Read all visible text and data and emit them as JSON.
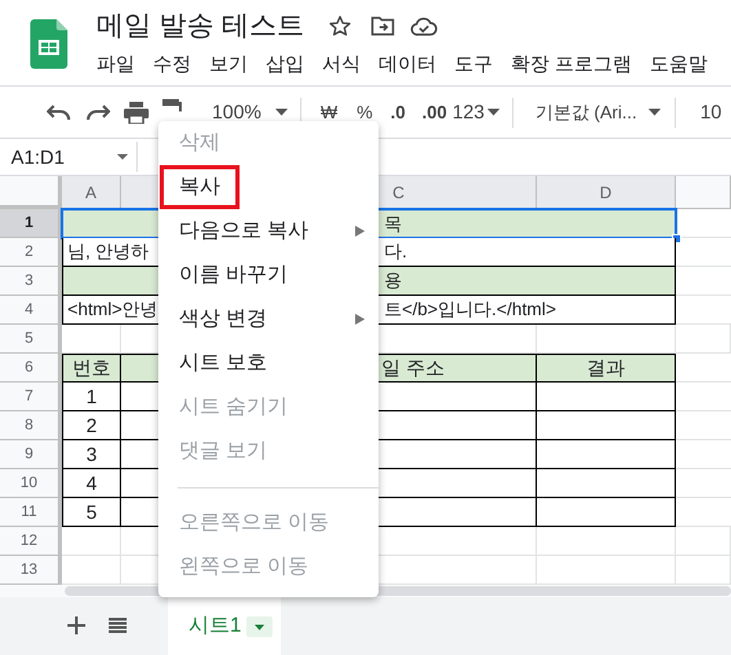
{
  "document": {
    "title": "메일 발송 테스트"
  },
  "menu_bar": [
    "파일",
    "수정",
    "보기",
    "삽입",
    "서식",
    "데이터",
    "도구",
    "확장 프로그램",
    "도움말"
  ],
  "toolbar": {
    "zoom": "100%",
    "currency": "₩",
    "percent": "%",
    "decrease_decimal": ".0",
    "increase_decimal": ".00",
    "number_format": "123",
    "font": "기본값 (Ari...",
    "font_size": "10"
  },
  "name_box": "A1:D1",
  "columns": [
    {
      "label": "A",
      "selected": true
    },
    {
      "label": "C",
      "selected": true
    },
    {
      "label": "D",
      "selected": true
    }
  ],
  "rows": [
    {
      "number": "1",
      "selected": true,
      "kind": "merged",
      "shaded": true,
      "right": "목"
    },
    {
      "number": "2",
      "selected": false,
      "kind": "merged",
      "shaded": false,
      "left": "님, 안녕하",
      "right": "다."
    },
    {
      "number": "3",
      "selected": false,
      "kind": "merged",
      "shaded": true,
      "right": "용"
    },
    {
      "number": "4",
      "selected": false,
      "kind": "merged",
      "shaded": false,
      "left": "<html>안녕",
      "right": "트</b>입니다.</html>"
    },
    {
      "number": "5",
      "selected": false,
      "kind": "empty"
    },
    {
      "number": "6",
      "selected": false,
      "kind": "table",
      "shaded": true,
      "a": "번호",
      "c": "일 주소",
      "d": "결과"
    },
    {
      "number": "7",
      "selected": false,
      "kind": "table",
      "shaded": false,
      "a": "1"
    },
    {
      "number": "8",
      "selected": false,
      "kind": "table",
      "shaded": false,
      "a": "2"
    },
    {
      "number": "9",
      "selected": false,
      "kind": "table",
      "shaded": false,
      "a": "3"
    },
    {
      "number": "10",
      "selected": false,
      "kind": "table",
      "shaded": false,
      "a": "4"
    },
    {
      "number": "11",
      "selected": false,
      "kind": "table",
      "shaded": false,
      "a": "5"
    },
    {
      "number": "12",
      "selected": false,
      "kind": "empty"
    },
    {
      "number": "13",
      "selected": false,
      "kind": "empty"
    }
  ],
  "context_menu": [
    {
      "kind": "item",
      "label": "삭제",
      "disabled": true,
      "submenu": false,
      "highlighted": false
    },
    {
      "kind": "item",
      "label": "복사",
      "disabled": false,
      "submenu": false,
      "highlighted": true
    },
    {
      "kind": "item",
      "label": "다음으로 복사",
      "disabled": false,
      "submenu": true,
      "highlighted": false
    },
    {
      "kind": "item",
      "label": "이름 바꾸기",
      "disabled": false,
      "submenu": false,
      "highlighted": false
    },
    {
      "kind": "item",
      "label": "색상 변경",
      "disabled": false,
      "submenu": true,
      "highlighted": false
    },
    {
      "kind": "item",
      "label": "시트 보호",
      "disabled": false,
      "submenu": false,
      "highlighted": false
    },
    {
      "kind": "item",
      "label": "시트 숨기기",
      "disabled": true,
      "submenu": false,
      "highlighted": false
    },
    {
      "kind": "item",
      "label": "댓글 보기",
      "disabled": true,
      "submenu": false,
      "highlighted": false
    },
    {
      "kind": "separator"
    },
    {
      "kind": "item",
      "label": "오른쪽으로 이동",
      "disabled": true,
      "submenu": false,
      "highlighted": false
    },
    {
      "kind": "item",
      "label": "왼쪽으로 이동",
      "disabled": true,
      "submenu": false,
      "highlighted": false
    }
  ],
  "sheet_tabs": [
    {
      "label": "시트1",
      "selected": true
    }
  ]
}
